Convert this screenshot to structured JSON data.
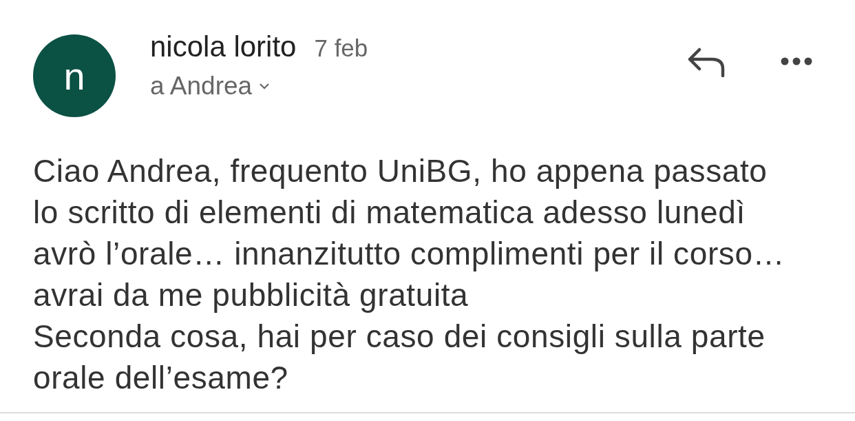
{
  "message": {
    "avatar": {
      "letter": "n",
      "color": "#0b5144"
    },
    "sender": "nicola lorito",
    "date": "7 feb",
    "recipient": "a Andrea",
    "body": "Ciao Andrea, frequento UniBG, ho appena passato\nlo scritto di elementi di matematica adesso lunedì\navrò l’orale… innanzitutto complimenti per il corso…\navrai da me pubblicità gratuita\nSeconda cosa, hai per caso dei consigli sulla parte\norale dell’esame?"
  }
}
